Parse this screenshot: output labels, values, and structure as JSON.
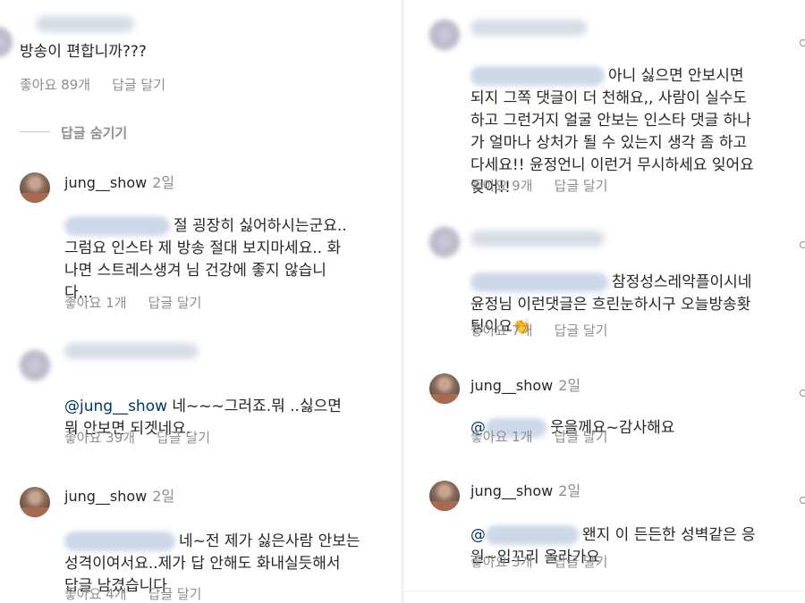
{
  "left": {
    "top_comment": {
      "text": "방송이 편합니까???",
      "likes": "좋아요 89개",
      "reply": "답글 달기"
    },
    "hide_replies": "답글 숨기기",
    "replies": [
      {
        "username": "jung__show",
        "time": "2일",
        "text": "절 굉장히 싫어하시는군요..\n그럼요 인스타 제 방송 절대 보지마세요.. 화\n나면 스트레스생겨 님 건강에 좋지 않습니\n다...",
        "likes": "좋아요 1개",
        "reply": "답글 달기"
      },
      {
        "username": "",
        "time": "",
        "mention": "@jung__show",
        "text": "네~~~그러죠.뭐 ..싫으면\n뭐 안보면 되겟네요.",
        "likes": "좋아요 39개",
        "reply": "답글 달기"
      },
      {
        "username": "jung__show",
        "time": "2일",
        "text": "네~전 제가 싫은사람 안보는\n성격이여서요..제가 답 안해도 화내실듯해서\n답글 남겼습니다",
        "likes": "좋아요 4개",
        "reply": "답글 달기"
      }
    ]
  },
  "right": {
    "comments": [
      {
        "text": "아니 싫으면 안보시면\n되지 그쪽 댓글이 더 천해요,, 사람이 실수도\n하고 그런거지 얼굴 안보는 인스타 댓글 하나\n가 얼마나 상처가 될 수 있는지 생각 좀 하고\n다세요!! 윤정언니 이런거 무시하세요 잊어요\n잊어!!",
        "likes": "좋아요 9개",
        "reply": "답글 달기"
      },
      {
        "text": "참정성스레악플이시네\n윤정님 이런댓글은 흐린눈하시구 오늘방송홧\n팅이요",
        "emoji": "👏",
        "likes": "좋아요 7개",
        "reply": "답글 달기"
      },
      {
        "username": "jung__show",
        "time": "2일",
        "mention": "@",
        "text": "웃을께요~감사해요",
        "likes": "좋아요 1개",
        "reply": "답글 달기"
      },
      {
        "username": "jung__show",
        "time": "2일",
        "mention": "@",
        "text": "왠지 이 든든한 성벽같은 응\n원~입꼬리 올라가요",
        "likes": "좋아요 3개",
        "reply": "답글 달기"
      }
    ]
  }
}
